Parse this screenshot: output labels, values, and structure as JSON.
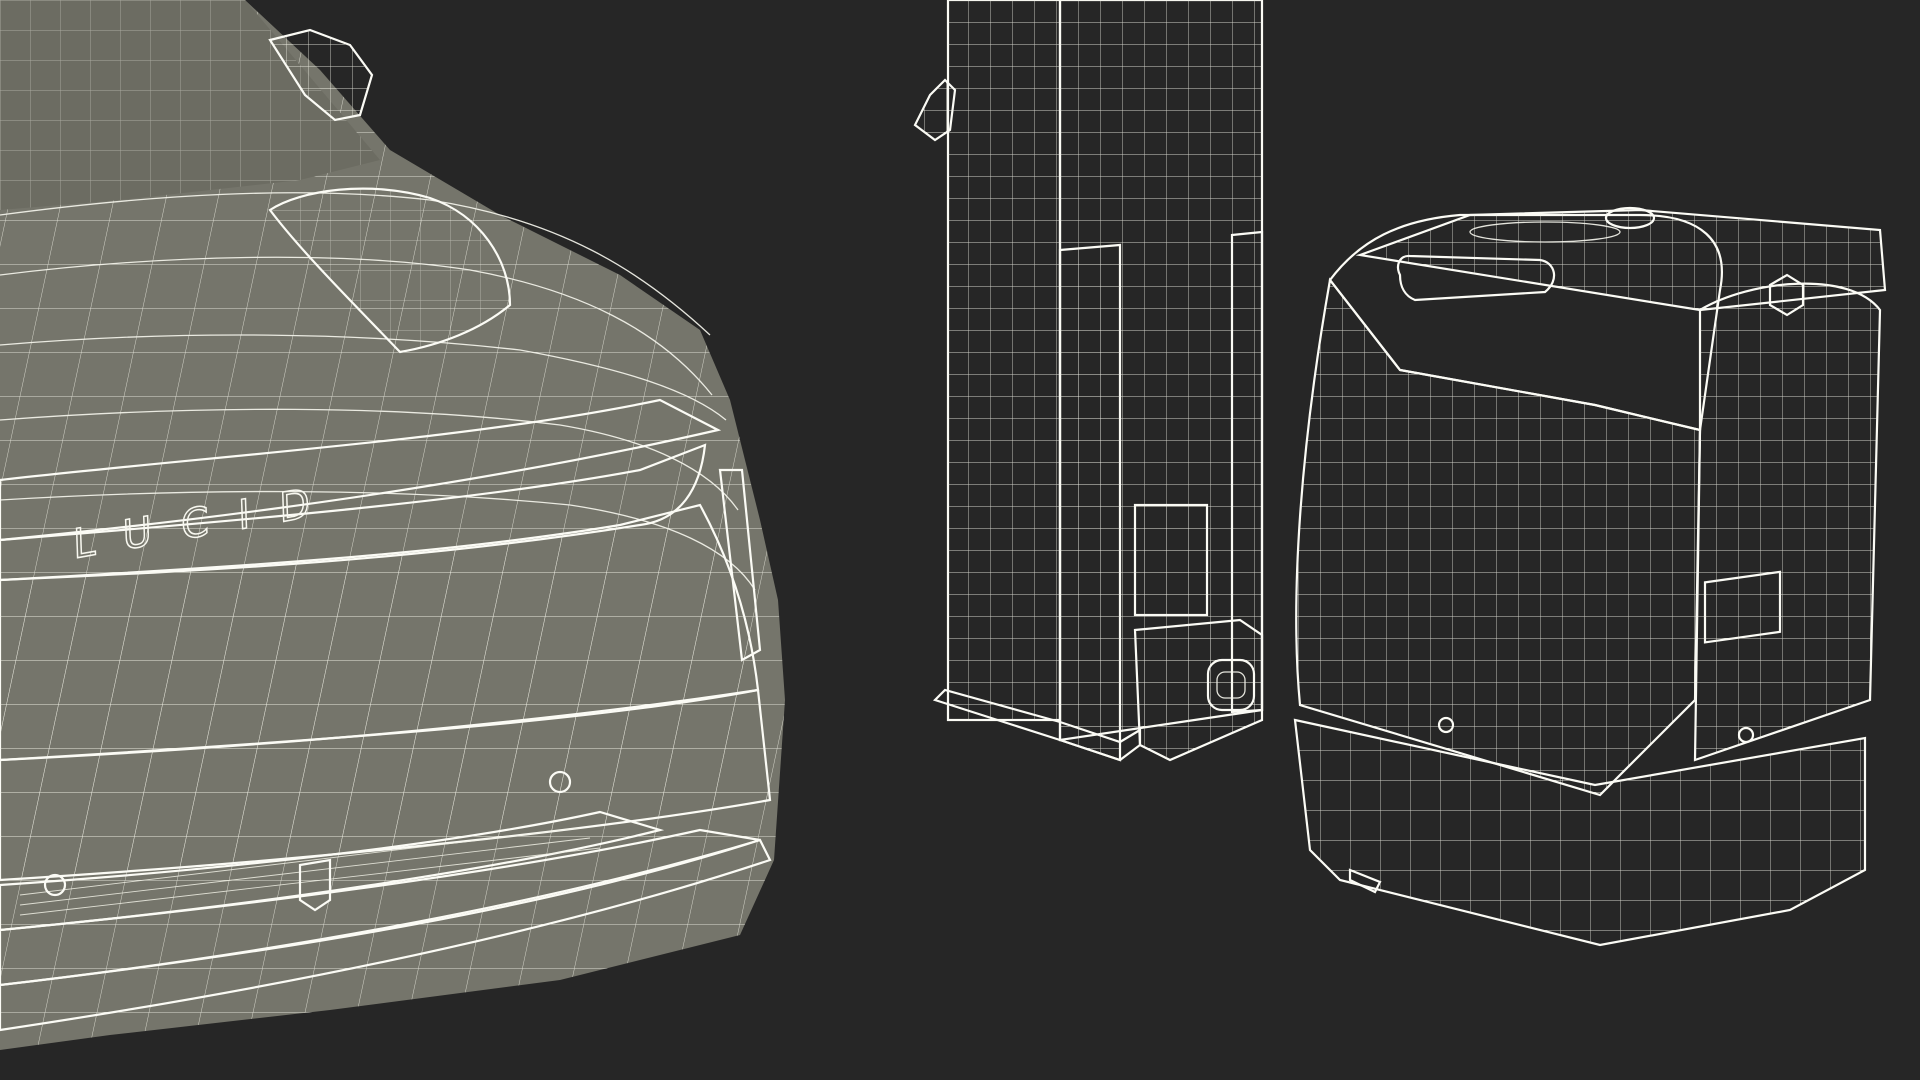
{
  "scene": {
    "background_color": "#262626",
    "surface_color": "#737369",
    "wire_color": "#f4f4ec",
    "objects": [
      {
        "id": "car-front",
        "icon": "car-front-wireframe"
      },
      {
        "id": "charging-pillar",
        "icon": "charger-pillar-wireframe"
      },
      {
        "id": "charging-unit",
        "icon": "charger-box-wireframe"
      }
    ]
  },
  "car": {
    "logo_text": "LUCID"
  }
}
